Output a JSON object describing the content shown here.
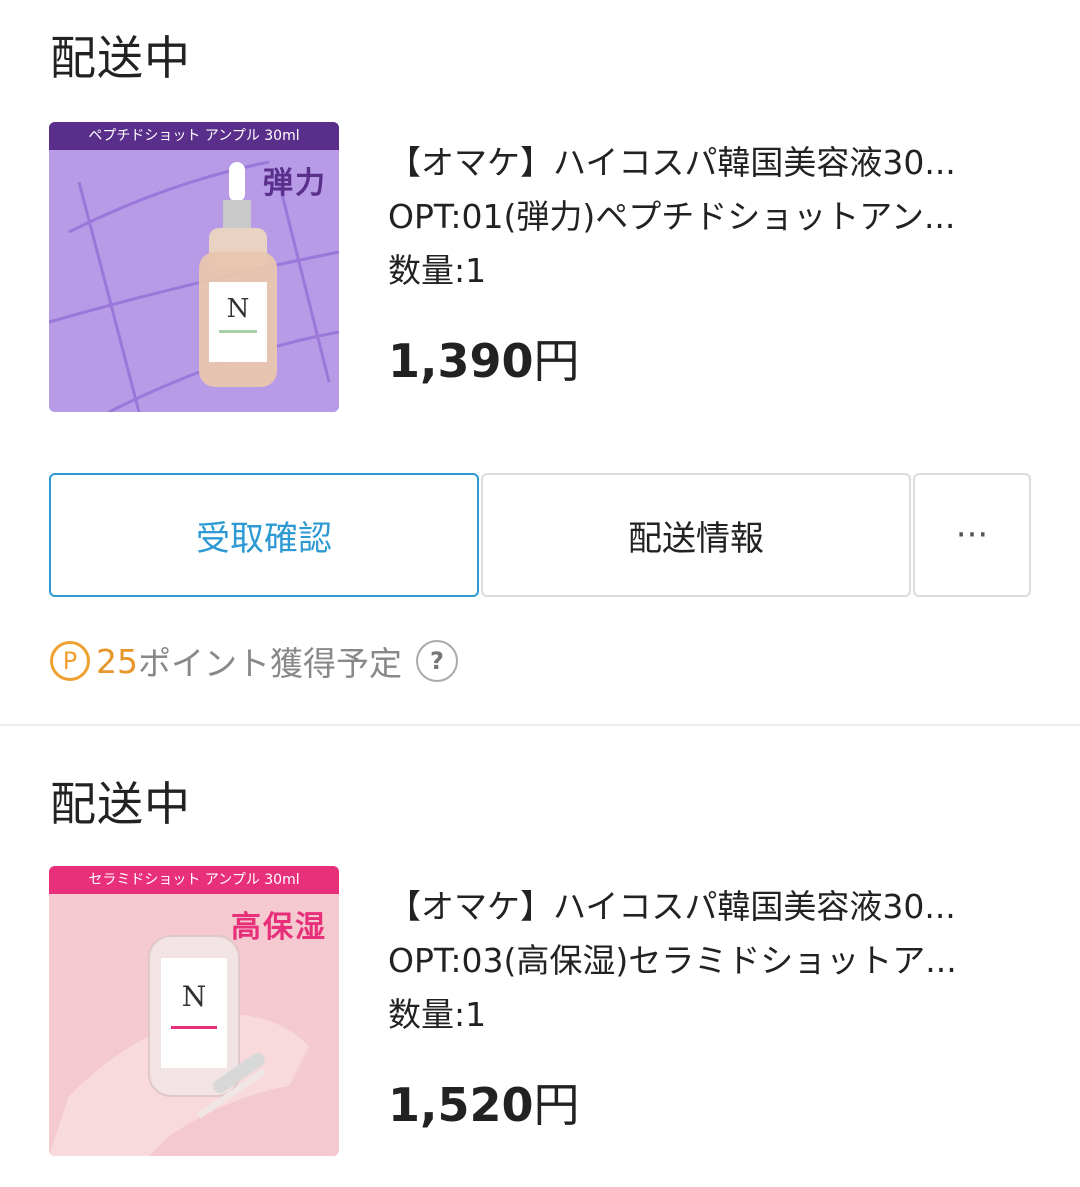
{
  "orders": [
    {
      "status": "配送中",
      "thumb": {
        "banner": "ペプチドショット アンプル 30ml",
        "tag": "弾力",
        "bg": "#b79be6",
        "banner_bg": "#5a2f8c",
        "tag_color": "#5a2f8c"
      },
      "title": "【オマケ】ハイコスパ韓国美容液30...",
      "option": "OPT:01(弾力)ペプチドショットアン...",
      "quantity": "数量:1",
      "price_num": "1,390",
      "price_unit": "円"
    },
    {
      "status": "配送中",
      "thumb": {
        "banner": "セラミドショット アンプル 30ml",
        "tag": "高保湿",
        "bg": "#f4c9cf",
        "banner_bg": "#e8307a",
        "tag_color": "#e8307a"
      },
      "title": "【オマケ】ハイコスパ韓国美容液30...",
      "option": "OPT:03(高保湿)セラミドショットア...",
      "quantity": "数量:1",
      "price_num": "1,520",
      "price_unit": "円"
    }
  ],
  "actions": {
    "confirm_label": "受取確認",
    "delivery_label": "配送情報",
    "more_label": "···"
  },
  "points": {
    "icon": "P",
    "amount": "25",
    "text": "ポイント獲得予定",
    "help": "?"
  },
  "colors": {
    "accent": "#2d9ad3",
    "points": "#e6962a"
  }
}
